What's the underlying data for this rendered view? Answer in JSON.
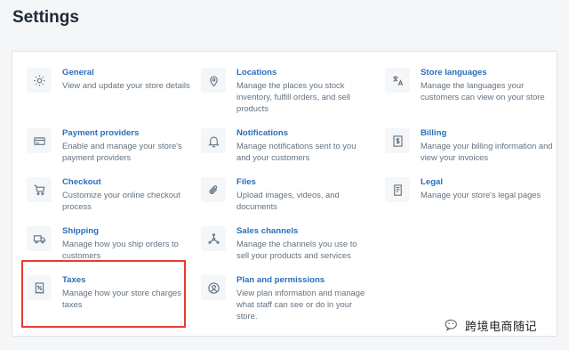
{
  "page": {
    "title": "Settings"
  },
  "settings": [
    {
      "title": "General",
      "desc": "View and update your store details",
      "icon": "gear-icon"
    },
    {
      "title": "Locations",
      "desc": "Manage the places you stock inventory, fulfill orders, and sell products",
      "icon": "location-pin-icon"
    },
    {
      "title": "Store languages",
      "desc": "Manage the languages your customers can view on your store",
      "icon": "translate-icon"
    },
    {
      "title": "Payment providers",
      "desc": "Enable and manage your store's payment providers",
      "icon": "credit-card-icon"
    },
    {
      "title": "Notifications",
      "desc": "Manage notifications sent to you and your customers",
      "icon": "bell-icon"
    },
    {
      "title": "Billing",
      "desc": "Manage your billing information and view your invoices",
      "icon": "invoice-dollar-icon"
    },
    {
      "title": "Checkout",
      "desc": "Customize your online checkout process",
      "icon": "cart-icon"
    },
    {
      "title": "Files",
      "desc": "Upload images, videos, and documents",
      "icon": "paperclip-icon"
    },
    {
      "title": "Legal",
      "desc": "Manage your store's legal pages",
      "icon": "legal-document-icon"
    },
    {
      "title": "Shipping",
      "desc": "Manage how you ship orders to customers",
      "icon": "truck-icon"
    },
    {
      "title": "Sales channels",
      "desc": "Manage the channels you use to sell your products and services",
      "icon": "channels-icon"
    },
    {
      "title": "Taxes",
      "desc": "Manage how your store charges taxes",
      "icon": "tax-receipt-icon"
    },
    {
      "title": "Plan and permissions",
      "desc": "View plan information and manage what staff can see or do in your store.",
      "icon": "account-circle-icon"
    }
  ],
  "watermark": {
    "text": "跨境电商随记"
  },
  "colors": {
    "link": "#2a6ebb",
    "muted": "#637381",
    "highlight": "#e53d2f",
    "background": "#f4f6f8"
  }
}
